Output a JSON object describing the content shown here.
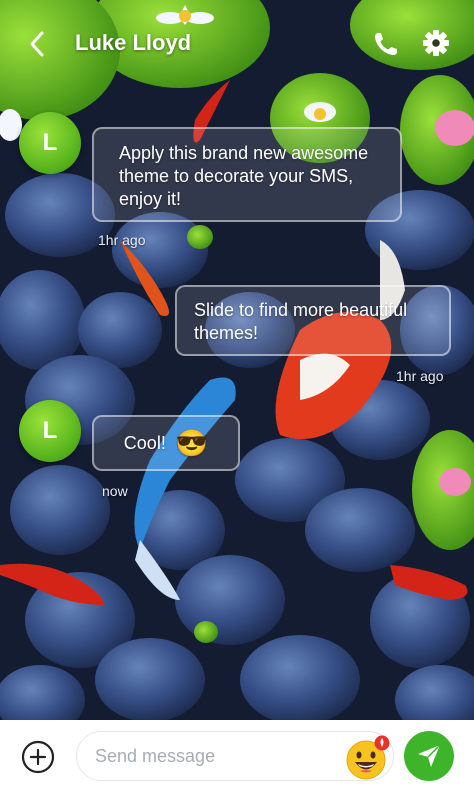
{
  "header": {
    "title": "Luke Lloyd",
    "back_icon": "chevron-left-icon",
    "call_icon": "phone-icon",
    "settings_icon": "gear-icon"
  },
  "messages": [
    {
      "direction": "incoming",
      "avatar_letter": "L",
      "text": "Apply this brand new awesome theme to decorate your SMS, enjoy it!",
      "timestamp": "1hr ago"
    },
    {
      "direction": "outgoing",
      "text": "Slide to find more beautiful themes!",
      "timestamp": "1hr ago"
    },
    {
      "direction": "incoming",
      "avatar_letter": "L",
      "text": "Cool!",
      "emoji": "😎",
      "timestamp": "now"
    }
  ],
  "composer": {
    "placeholder": "Send message",
    "add_icon": "plus-circle-icon",
    "emoji_icon": "grinning-face-icon",
    "send_icon": "paper-plane-icon"
  },
  "colors": {
    "accent_green": "#3db42a",
    "avatar_green": "#5cb81f",
    "bubble_border": "#ffffff",
    "badge_red": "#e8332a"
  }
}
